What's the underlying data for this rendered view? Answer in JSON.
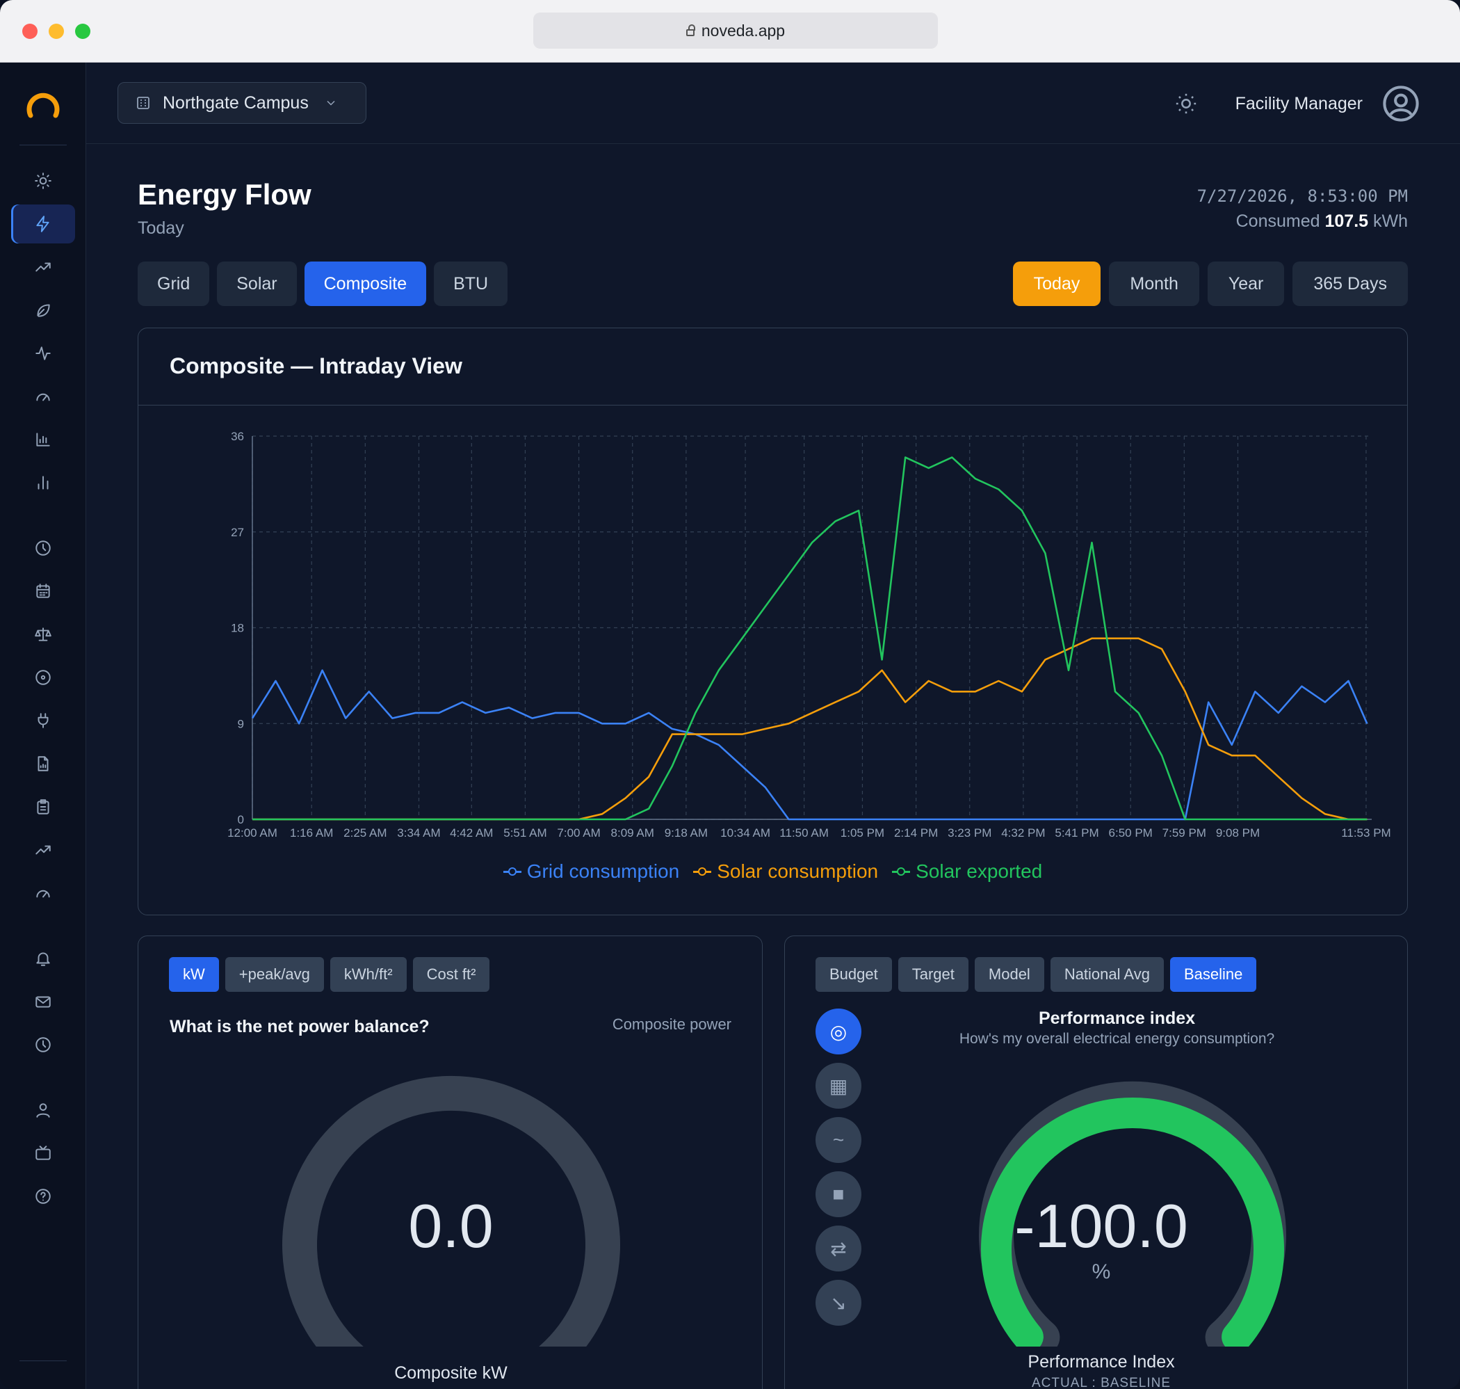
{
  "browser": {
    "url": "noveda.app"
  },
  "header": {
    "site_selector": "Northgate Campus",
    "user": "Facility Manager"
  },
  "page": {
    "title": "Energy Flow",
    "subtitle": "Today",
    "datetime": "7/27/2026, 8:53:00 PM",
    "consumed_prefix": "Consumed",
    "consumed_value": "107.5",
    "consumed_unit": "kWh"
  },
  "tabs": [
    {
      "label": "Grid",
      "active": false
    },
    {
      "label": "Solar",
      "active": false
    },
    {
      "label": "Composite",
      "active": true
    },
    {
      "label": "BTU",
      "active": false
    }
  ],
  "periods": [
    {
      "label": "Today",
      "active": true
    },
    {
      "label": "Month",
      "active": false
    },
    {
      "label": "Year",
      "active": false
    },
    {
      "label": "365 Days",
      "active": false
    }
  ],
  "chart_card": {
    "title": "Composite — Intraday View"
  },
  "chart_data": {
    "type": "line",
    "title": "Composite — Intraday View",
    "ylim": [
      0,
      36
    ],
    "yticks": [
      0,
      9,
      18,
      27,
      36
    ],
    "x_tick_labels": [
      "12:00 AM",
      "1:16 AM",
      "2:25 AM",
      "3:34 AM",
      "4:42 AM",
      "5:51 AM",
      "7:00 AM",
      "8:09 AM",
      "9:18 AM",
      "10:34 AM",
      "11:50 AM",
      "1:05 PM",
      "2:14 PM",
      "3:23 PM",
      "4:32 PM",
      "5:41 PM",
      "6:50 PM",
      "7:59 PM",
      "9:08 PM",
      "11:53 PM"
    ],
    "x_tick_hours": [
      0,
      1.27,
      2.42,
      3.57,
      4.7,
      5.85,
      7.0,
      8.15,
      9.3,
      10.57,
      11.83,
      13.08,
      14.23,
      15.38,
      16.53,
      17.68,
      18.83,
      19.98,
      21.13,
      23.88
    ],
    "grid": true,
    "legend_position": "bottom-center",
    "x_hours": [
      0,
      0.5,
      1,
      1.5,
      2,
      2.5,
      3,
      3.5,
      4,
      4.5,
      5,
      5.5,
      6,
      6.5,
      7,
      7.5,
      8,
      8.5,
      9,
      9.5,
      10,
      10.5,
      11,
      11.5,
      12,
      12.5,
      13,
      13.5,
      14,
      14.5,
      15,
      15.5,
      16,
      16.5,
      17,
      17.5,
      18,
      18.5,
      19,
      19.5,
      20,
      20.5,
      21,
      21.5,
      22,
      22.5,
      23,
      23.5,
      23.9
    ],
    "series": [
      {
        "name": "Grid consumption",
        "color": "#3b82f6",
        "values": [
          9.5,
          13,
          9,
          14,
          9.5,
          12,
          9.5,
          10,
          10,
          11,
          10,
          10.5,
          9.5,
          10,
          10,
          9,
          9,
          10,
          8.5,
          8,
          7,
          5,
          3,
          0,
          0,
          0,
          0,
          0,
          0,
          0,
          0,
          0,
          0,
          0,
          0,
          0,
          0,
          0,
          0,
          0,
          0,
          11,
          7,
          12,
          10,
          12.5,
          11,
          13,
          9
        ]
      },
      {
        "name": "Solar consumption",
        "color": "#f59e0b",
        "values": [
          0,
          0,
          0,
          0,
          0,
          0,
          0,
          0,
          0,
          0,
          0,
          0,
          0,
          0,
          0,
          0.5,
          2,
          4,
          8,
          8,
          8,
          8,
          8.5,
          9,
          10,
          11,
          12,
          14,
          11,
          13,
          12,
          12,
          13,
          12,
          15,
          16,
          17,
          17,
          17,
          16,
          12,
          7,
          6,
          6,
          4,
          2,
          0.5,
          0,
          0
        ]
      },
      {
        "name": "Solar exported",
        "color": "#22c55e",
        "values": [
          0,
          0,
          0,
          0,
          0,
          0,
          0,
          0,
          0,
          0,
          0,
          0,
          0,
          0,
          0,
          0,
          0,
          1,
          5,
          10,
          14,
          17,
          20,
          23,
          26,
          28,
          29,
          15,
          34,
          33,
          34,
          32,
          31,
          29,
          25,
          14,
          26,
          12,
          10,
          6,
          0,
          0,
          0,
          0,
          0,
          0,
          0,
          0,
          0
        ]
      }
    ]
  },
  "left_card": {
    "chips": [
      {
        "label": "kW",
        "active": true
      },
      {
        "label": "+peak/avg",
        "active": false
      },
      {
        "label": "kWh/ft²",
        "active": false
      },
      {
        "label": "Cost ft²",
        "active": false
      }
    ],
    "question": "What is the net power balance?",
    "right_label": "Composite power",
    "gauge_value": "0.0",
    "gauge_fraction": 0,
    "gauge_label": "Composite kW"
  },
  "right_card": {
    "chips": [
      {
        "label": "Budget",
        "active": false
      },
      {
        "label": "Target",
        "active": false
      },
      {
        "label": "Model",
        "active": false
      },
      {
        "label": "National Avg",
        "active": false
      },
      {
        "label": "Baseline",
        "active": true
      }
    ],
    "side_buttons": [
      {
        "icon": "target-icon",
        "glyph": "◎",
        "active": true
      },
      {
        "icon": "grid-icon",
        "glyph": "▦",
        "active": false
      },
      {
        "icon": "wave-icon",
        "glyph": "~",
        "active": false
      },
      {
        "icon": "square-icon",
        "glyph": "■",
        "active": false
      },
      {
        "icon": "swap-icon",
        "glyph": "⇄",
        "active": false
      },
      {
        "icon": "arrow-down-right-icon",
        "glyph": "↘",
        "active": false
      }
    ],
    "title": "Performance index",
    "subtitle": "How's my overall electrical energy consumption?",
    "gauge_value": "-100.0",
    "gauge_unit": "%",
    "gauge_fraction": 1,
    "gauge_color": "#22c55e",
    "gauge_label": "Performance Index",
    "gauge_sublabel": "ACTUAL : BASELINE"
  }
}
